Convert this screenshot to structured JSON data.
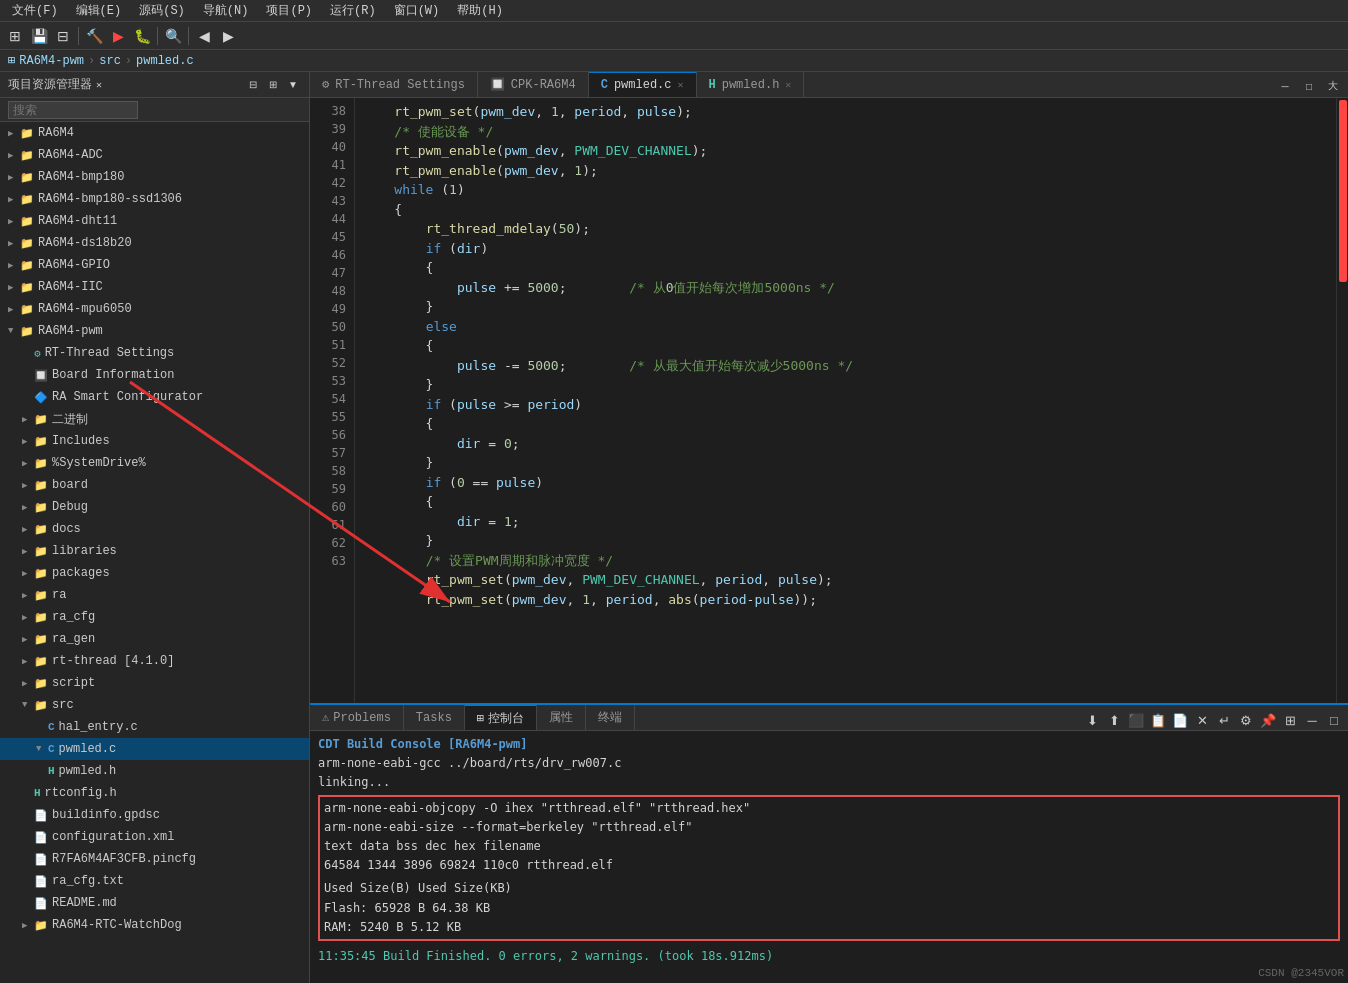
{
  "menubar": {
    "items": [
      "文件(F)",
      "编辑(E)",
      "源码(S)",
      "导航(N)",
      "项目(P)",
      "运行(R)",
      "窗口(W)",
      "帮助(H)"
    ]
  },
  "breadcrumb": {
    "parts": [
      "RA6M4-pwm",
      "src",
      "pwmled.c"
    ]
  },
  "sidebar": {
    "title": "项目资源管理器",
    "search_placeholder": "搜索",
    "tree": [
      {
        "indent": 0,
        "arrow": "▶",
        "icon": "📁",
        "label": "RA6M4",
        "type": "folder"
      },
      {
        "indent": 0,
        "arrow": "▶",
        "icon": "📁",
        "label": "RA6M4-ADC",
        "type": "folder"
      },
      {
        "indent": 0,
        "arrow": "▶",
        "icon": "📁",
        "label": "RA6M4-bmp180",
        "type": "folder"
      },
      {
        "indent": 0,
        "arrow": "▶",
        "icon": "📁",
        "label": "RA6M4-bmp180-ssd1306",
        "type": "folder"
      },
      {
        "indent": 0,
        "arrow": "▶",
        "icon": "📁",
        "label": "RA6M4-dht11",
        "type": "folder"
      },
      {
        "indent": 0,
        "arrow": "▶",
        "icon": "📁",
        "label": "RA6M4-ds18b20",
        "type": "folder"
      },
      {
        "indent": 0,
        "arrow": "▶",
        "icon": "📁",
        "label": "RA6M4-GPIO",
        "type": "folder"
      },
      {
        "indent": 0,
        "arrow": "▶",
        "icon": "📁",
        "label": "RA6M4-IIC",
        "type": "folder"
      },
      {
        "indent": 0,
        "arrow": "▶",
        "icon": "📁",
        "label": "RA6M4-mpu6050",
        "type": "folder"
      },
      {
        "indent": 0,
        "arrow": "▼",
        "icon": "📁",
        "label": "RA6M4-pwm",
        "type": "folder",
        "expanded": true
      },
      {
        "indent": 1,
        "arrow": " ",
        "icon": "⚙",
        "label": "RT-Thread Settings",
        "type": "settings",
        "color": "#4ec9b0"
      },
      {
        "indent": 1,
        "arrow": " ",
        "icon": "🔲",
        "label": "Board Information",
        "type": "info",
        "color": "#4ec9b0"
      },
      {
        "indent": 1,
        "arrow": " ",
        "icon": "🔷",
        "label": "RA Smart Configurator",
        "type": "config",
        "color": "#4ec9b0"
      },
      {
        "indent": 1,
        "arrow": "▶",
        "icon": "📁",
        "label": "二进制",
        "type": "folder"
      },
      {
        "indent": 1,
        "arrow": "▶",
        "icon": "📁",
        "label": "Includes",
        "type": "folder"
      },
      {
        "indent": 1,
        "arrow": "▶",
        "icon": "📁",
        "label": "%SystemDrive%",
        "type": "folder"
      },
      {
        "indent": 1,
        "arrow": "▶",
        "icon": "📁",
        "label": "board",
        "type": "folder"
      },
      {
        "indent": 1,
        "arrow": "▶",
        "icon": "📁",
        "label": "Debug",
        "type": "folder"
      },
      {
        "indent": 1,
        "arrow": "▶",
        "icon": "📁",
        "label": "docs",
        "type": "folder"
      },
      {
        "indent": 1,
        "arrow": "▶",
        "icon": "📁",
        "label": "libraries",
        "type": "folder"
      },
      {
        "indent": 1,
        "arrow": "▶",
        "icon": "📁",
        "label": "packages",
        "type": "folder"
      },
      {
        "indent": 1,
        "arrow": "▶",
        "icon": "📁",
        "label": "ra",
        "type": "folder"
      },
      {
        "indent": 1,
        "arrow": "▶",
        "icon": "📁",
        "label": "ra_cfg",
        "type": "folder"
      },
      {
        "indent": 1,
        "arrow": "▶",
        "icon": "📁",
        "label": "ra_gen",
        "type": "folder"
      },
      {
        "indent": 1,
        "arrow": "▶",
        "icon": "📁",
        "label": "rt-thread [4.1.0]",
        "type": "folder"
      },
      {
        "indent": 1,
        "arrow": "▶",
        "icon": "📁",
        "label": "script",
        "type": "folder"
      },
      {
        "indent": 1,
        "arrow": "▼",
        "icon": "📁",
        "label": "src",
        "type": "folder",
        "expanded": true
      },
      {
        "indent": 2,
        "arrow": " ",
        "icon": "C",
        "label": "hal_entry.c",
        "type": "c-file"
      },
      {
        "indent": 2,
        "arrow": "▼",
        "icon": "C",
        "label": "pwmled.c",
        "type": "c-file",
        "selected": true
      },
      {
        "indent": 2,
        "arrow": " ",
        "icon": "H",
        "label": "pwmled.h",
        "type": "h-file"
      },
      {
        "indent": 1,
        "arrow": " ",
        "icon": "C",
        "label": "rtconfig.h",
        "type": "h-file"
      },
      {
        "indent": 1,
        "arrow": " ",
        "icon": "📄",
        "label": "buildinfo.gpdsc",
        "type": "file"
      },
      {
        "indent": 1,
        "arrow": " ",
        "icon": "📄",
        "label": "configuration.xml",
        "type": "file"
      },
      {
        "indent": 1,
        "arrow": " ",
        "icon": "📄",
        "label": "R7FA6M4AF3CFB.pincfg",
        "type": "file"
      },
      {
        "indent": 1,
        "arrow": " ",
        "icon": "📄",
        "label": "ra_cfg.txt",
        "type": "file"
      },
      {
        "indent": 1,
        "arrow": " ",
        "icon": "📄",
        "label": "README.md",
        "type": "file"
      },
      {
        "indent": 1,
        "arrow": "▶",
        "icon": "📁",
        "label": "RA6M4-RTC-WatchDog",
        "type": "folder"
      }
    ]
  },
  "tabs": {
    "items": [
      {
        "label": "RT-Thread Settings",
        "active": false,
        "closable": false
      },
      {
        "label": "CPK-RA6M4",
        "active": false,
        "closable": false
      },
      {
        "label": "pwmled.c",
        "active": true,
        "closable": true
      },
      {
        "label": "pwmled.h",
        "active": false,
        "closable": true
      }
    ]
  },
  "code": {
    "lines": [
      {
        "num": 38,
        "content": "    rt_pwm_set(pwm_dev, 1, period, pulse);",
        "tokens": []
      },
      {
        "num": 39,
        "content": "    /* 使能设备 */",
        "comment": true
      },
      {
        "num": 40,
        "content": "    rt_pwm_enable(pwm_dev, PWM_DEV_CHANNEL);",
        "tokens": []
      },
      {
        "num": 41,
        "content": "    rt_pwm_enable(pwm_dev, 1);",
        "tokens": []
      },
      {
        "num": 42,
        "content": "    while (1)",
        "tokens": []
      },
      {
        "num": 43,
        "content": "    {",
        "tokens": []
      },
      {
        "num": 44,
        "content": "        rt_thread_mdelay(50);",
        "tokens": []
      },
      {
        "num": 45,
        "content": "        if (dir)",
        "tokens": []
      },
      {
        "num": 46,
        "content": "        {",
        "tokens": []
      },
      {
        "num": 47,
        "content": "            pulse += 5000;        /* 从0值开始每次增加5000ns */",
        "tokens": []
      },
      {
        "num": 48,
        "content": "        }",
        "tokens": []
      },
      {
        "num": 49,
        "content": "        else",
        "tokens": []
      },
      {
        "num": 50,
        "content": "        {",
        "tokens": []
      },
      {
        "num": 51,
        "content": "            pulse -= 5000;        /* 从最大值开始每次减少5000ns */",
        "tokens": []
      },
      {
        "num": 52,
        "content": "        }",
        "tokens": []
      },
      {
        "num": 53,
        "content": "        if (pulse >= period)",
        "tokens": []
      },
      {
        "num": 54,
        "content": "        {",
        "tokens": []
      },
      {
        "num": 55,
        "content": "            dir = 0;",
        "tokens": []
      },
      {
        "num": 56,
        "content": "        }",
        "tokens": []
      },
      {
        "num": 57,
        "content": "        if (0 == pulse)",
        "tokens": []
      },
      {
        "num": 58,
        "content": "        {",
        "tokens": []
      },
      {
        "num": 59,
        "content": "            dir = 1;",
        "tokens": []
      },
      {
        "num": 60,
        "content": "        }",
        "tokens": []
      },
      {
        "num": 61,
        "content": "        /* 设置PWM周期和脉冲宽度 */",
        "comment": true
      },
      {
        "num": 62,
        "content": "        rt_pwm_set(pwm_dev, PWM_DEV_CHANNEL, period, pulse);",
        "tokens": []
      },
      {
        "num": 63,
        "content": "        rt_pwm_set(pwm_dev, 1, period, abs(period-pulse));",
        "tokens": []
      }
    ]
  },
  "bottom_panel": {
    "tabs": [
      {
        "label": "Problems",
        "active": false
      },
      {
        "label": "Tasks",
        "active": false
      },
      {
        "label": "控制台",
        "active": true
      },
      {
        "label": "属性",
        "active": false
      },
      {
        "label": "终端",
        "active": false
      }
    ],
    "console_title": "CDT Build Console [RA6M4-pwm]",
    "console_lines": [
      "arm-none-eabi-gcc ../board/rts/drv_rw007.c",
      "linking...",
      "arm-none-eabi-objcopy -O ihex \"rtthread.elf\"  \"rtthread.hex\"",
      "arm-none-eabi-size --format=berkeley \"rtthread.elf\"",
      "   text    data     bss     dec     hex filename",
      "  64584    1344    3896   69824   110c0 rtthread.elf",
      "",
      "           Used Size(B)         Used Size(KB)",
      "Flash:         65928 B               64.38 KB",
      "RAM:            5240 B                5.12 KB",
      "",
      "11:35:45 Build Finished. 0 errors, 2 warnings. (took 18s.912ms)"
    ]
  },
  "watermark": "CSDN @2345VOR"
}
